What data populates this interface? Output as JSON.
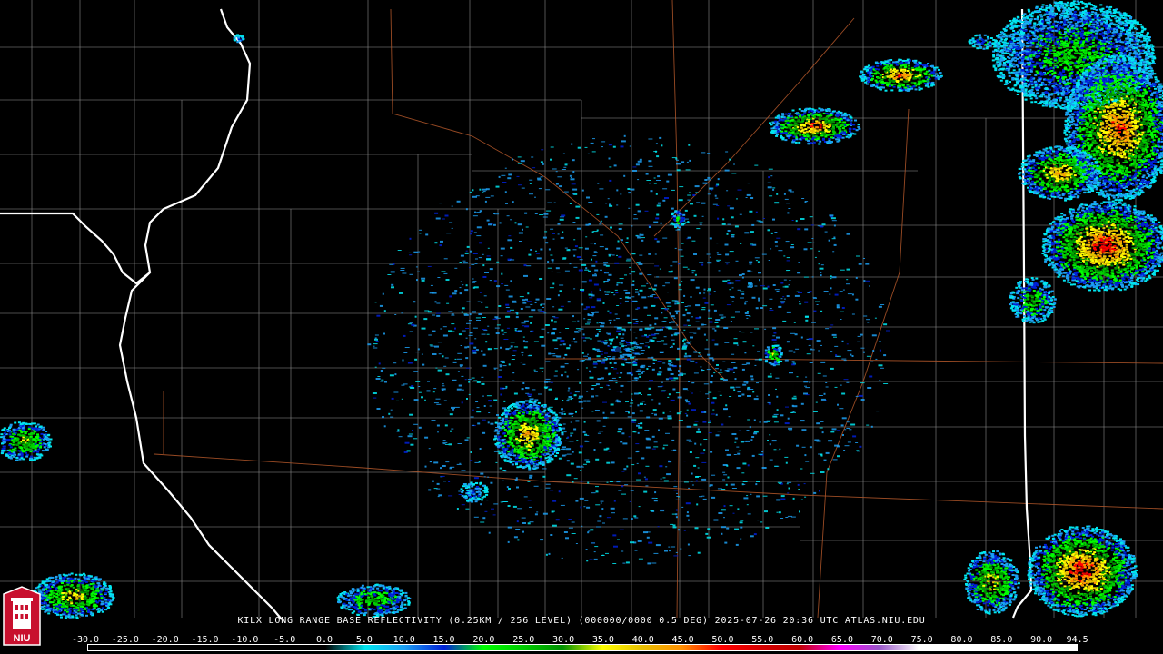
{
  "caption": "KILX LONG RANGE BASE REFLECTIVITY (0.25KM / 256 LEVEL) (000000/0000 0.5 DEG) 2025-07-26 20:36 UTC  ATLAS.NIU.EDU",
  "logo": {
    "text": "NIU"
  },
  "scale": {
    "min": -30,
    "max": 95,
    "labels": [
      "-30.0",
      "-25.0",
      "-20.0",
      "-15.0",
      "-10.0",
      "-5.0",
      "0.0",
      "5.0",
      "10.0",
      "15.0",
      "20.0",
      "25.0",
      "30.0",
      "35.0",
      "40.0",
      "45.0",
      "50.0",
      "55.0",
      "60.0",
      "65.0",
      "70.0",
      "75.0",
      "80.0",
      "85.0",
      "90.0",
      "94.5"
    ],
    "color_stops": [
      {
        "dbz": -30,
        "color": "#000000"
      },
      {
        "dbz": 0,
        "color": "#000000"
      },
      {
        "dbz": 5,
        "color": "#00e6f0"
      },
      {
        "dbz": 10,
        "color": "#1c9ff2"
      },
      {
        "dbz": 15,
        "color": "#0020d8"
      },
      {
        "dbz": 20,
        "color": "#00ff00"
      },
      {
        "dbz": 25,
        "color": "#00cc00"
      },
      {
        "dbz": 30,
        "color": "#009000"
      },
      {
        "dbz": 35,
        "color": "#ffff00"
      },
      {
        "dbz": 40,
        "color": "#e7c000"
      },
      {
        "dbz": 45,
        "color": "#ff9000"
      },
      {
        "dbz": 50,
        "color": "#ff0000"
      },
      {
        "dbz": 55,
        "color": "#d60000"
      },
      {
        "dbz": 60,
        "color": "#c00000"
      },
      {
        "dbz": 65,
        "color": "#ff00ff"
      },
      {
        "dbz": 70,
        "color": "#9955c9"
      },
      {
        "dbz": 75,
        "color": "#ffffff"
      },
      {
        "dbz": 95,
        "color": "#ffffff"
      }
    ]
  }
}
